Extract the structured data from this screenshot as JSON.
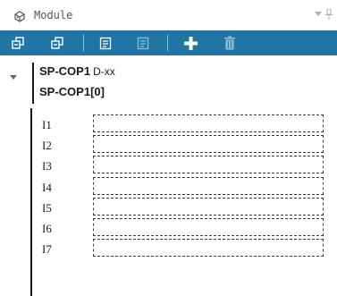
{
  "panel": {
    "title": "Module",
    "title_icon": "module-icon",
    "chevron_icon": "chevron-down-icon",
    "pin_icon": "pin-icon"
  },
  "toolbar": {
    "background": "#2175a4",
    "buttons": [
      {
        "icon": "expand-all-icon",
        "enabled": true
      },
      {
        "icon": "collapse-all-icon",
        "enabled": true
      },
      {
        "icon": "edit-comment-icon",
        "enabled": true
      },
      {
        "icon": "edit-comment-disabled-icon",
        "enabled": false
      },
      {
        "icon": "add-icon",
        "enabled": true
      },
      {
        "icon": "delete-icon",
        "enabled": false
      }
    ]
  },
  "module": {
    "name": "SP-COP1",
    "variant": "D-xx",
    "instance": "SP-COP1[0]",
    "expanded": true
  },
  "io": [
    {
      "label": "I1",
      "value": ""
    },
    {
      "label": "I2",
      "value": ""
    },
    {
      "label": "I3",
      "value": ""
    },
    {
      "label": "I4",
      "value": ""
    },
    {
      "label": "I5",
      "value": ""
    },
    {
      "label": "I6",
      "value": ""
    },
    {
      "label": "I7",
      "value": ""
    }
  ]
}
